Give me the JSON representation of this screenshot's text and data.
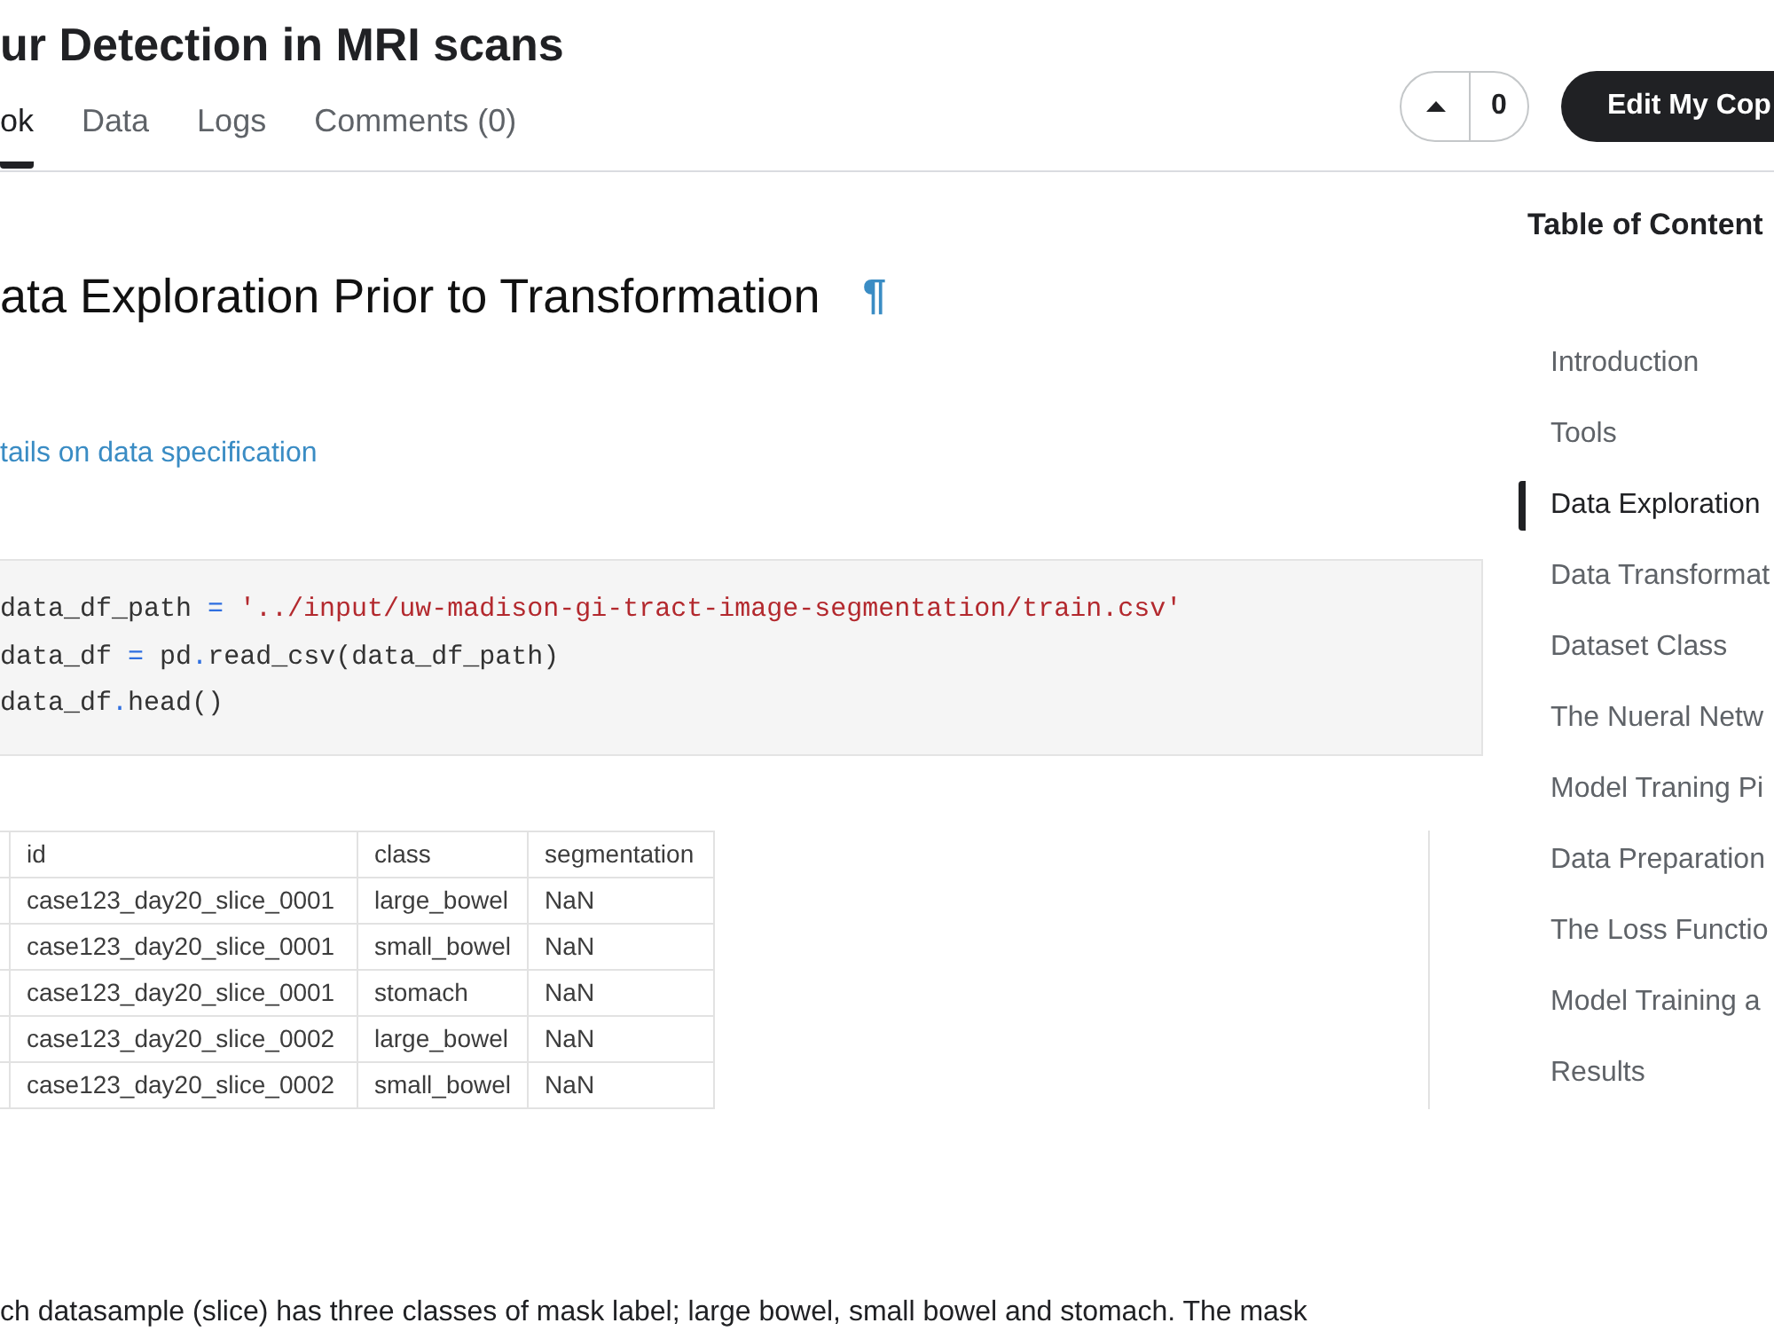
{
  "notebook": {
    "title": "ur Detection in MRI scans",
    "tabs": [
      {
        "label": "ok",
        "selected": true
      },
      {
        "label": "Data",
        "selected": false
      },
      {
        "label": "Logs",
        "selected": false
      },
      {
        "label": "Comments (0)",
        "selected": false
      }
    ],
    "upvote": {
      "count": "0"
    },
    "edit_button": "Edit My Cop"
  },
  "content": {
    "heading": "ata Exploration Prior to Transformation",
    "anchor": "¶",
    "link": "tails on data specification",
    "code_lines": [
      [
        {
          "kind": "name",
          "text": "data_df_path "
        },
        {
          "kind": "operator",
          "text": "="
        },
        {
          "kind": "string",
          "text": " '../input/uw-madison-gi-tract-image-segmentation/train.csv'"
        }
      ],
      [
        {
          "kind": "name",
          "text": "data_df "
        },
        {
          "kind": "operator",
          "text": "="
        },
        {
          "kind": "name",
          "text": " pd"
        },
        {
          "kind": "operator",
          "text": "."
        },
        {
          "kind": "name",
          "text": "read_csv(data_df_path)"
        }
      ],
      [
        {
          "kind": "name",
          "text": "data_df"
        },
        {
          "kind": "operator",
          "text": "."
        },
        {
          "kind": "name",
          "text": "head()"
        }
      ]
    ],
    "output_table": {
      "columns": [
        "id",
        "class",
        "segmentation"
      ],
      "rows": [
        [
          "case123_day20_slice_0001",
          "large_bowel",
          "NaN"
        ],
        [
          "case123_day20_slice_0001",
          "small_bowel",
          "NaN"
        ],
        [
          "case123_day20_slice_0001",
          "stomach",
          "NaN"
        ],
        [
          "case123_day20_slice_0002",
          "large_bowel",
          "NaN"
        ],
        [
          "case123_day20_slice_0002",
          "small_bowel",
          "NaN"
        ]
      ]
    },
    "paragraph": "ch datasample (slice) has three classes of mask label; large bowel, small bowel and stomach. The mask"
  },
  "toc": {
    "title": "Table of Content",
    "items": [
      {
        "label": "Introduction",
        "selected": false
      },
      {
        "label": "Tools",
        "selected": false
      },
      {
        "label": "Data Exploration",
        "selected": true
      },
      {
        "label": "Data Transformat",
        "selected": false
      },
      {
        "label": "Dataset Class",
        "selected": false
      },
      {
        "label": "The Nueral Netw",
        "selected": false
      },
      {
        "label": "Model Traning Pi",
        "selected": false
      },
      {
        "label": "Data Preparation",
        "selected": false
      },
      {
        "label": "The Loss Functio",
        "selected": false
      },
      {
        "label": "Model Training a",
        "selected": false
      },
      {
        "label": "Results",
        "selected": false
      }
    ]
  }
}
